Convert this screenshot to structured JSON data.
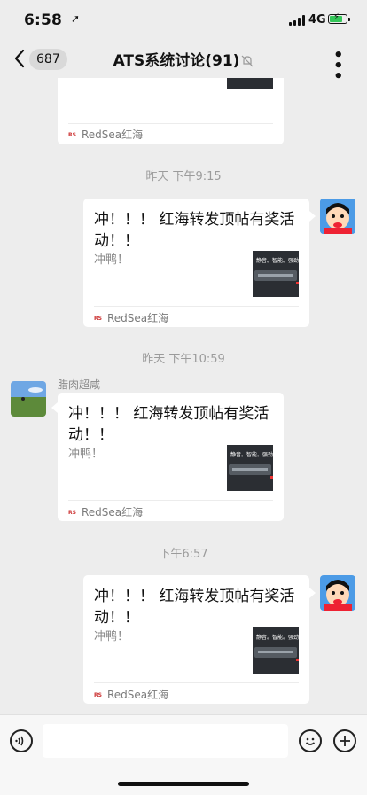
{
  "status_bar": {
    "time": "6:58",
    "network": "4G"
  },
  "nav": {
    "back_badge": "687",
    "title": "ATS系统讨论(91)"
  },
  "messages": [
    {
      "sender": "",
      "title": "",
      "desc": "",
      "source": "RedSea红海"
    },
    {
      "time": "昨天 下午9:15"
    },
    {
      "sender": "",
      "title": "冲！！！ 红海转发顶帖有奖活动！！",
      "desc": "冲鸭！",
      "source": "RedSea红海"
    },
    {
      "time": "昨天 下午10:59"
    },
    {
      "sender": "腊肉超咸",
      "title": "冲！！！ 红海转发顶帖有奖活动！！",
      "desc": "冲鸭！",
      "source": "RedSea红海"
    },
    {
      "time": "下午6:57"
    },
    {
      "sender": "",
      "title": "冲！！！ 红海转发顶帖有奖活动！！",
      "desc": "冲鸭！",
      "source": "RedSea红海"
    }
  ],
  "thumbnail_text": "静音。智能。强劲。",
  "colors": {
    "battery": "#34c759",
    "background": "#ededed"
  }
}
